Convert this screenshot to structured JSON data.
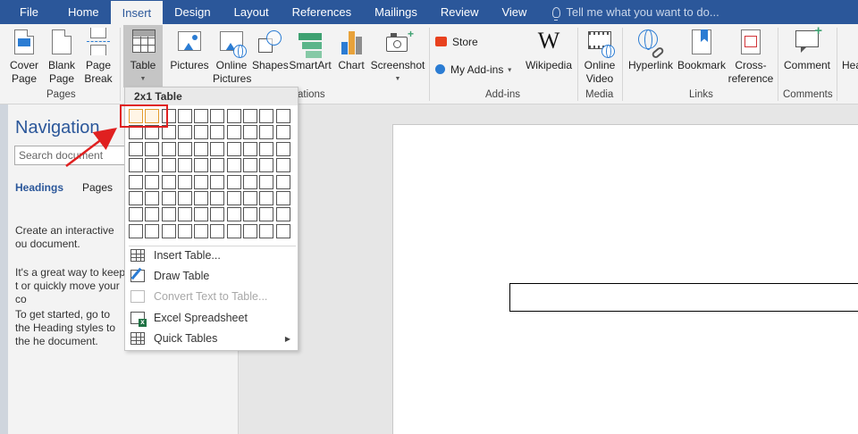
{
  "tabs": [
    "File",
    "Home",
    "Insert",
    "Design",
    "Layout",
    "References",
    "Mailings",
    "Review",
    "View"
  ],
  "active_tab": "Insert",
  "tell_me": "Tell me what you want to do...",
  "ribbon": {
    "cover_page": "Cover\nPage",
    "blank_page": "Blank\nPage",
    "page_break": "Page\nBreak",
    "pages_group": "Pages",
    "table": "Table",
    "pictures": "Pictures",
    "online_pictures": "Online\nPictures",
    "shapes": "Shapes",
    "smartart": "SmartArt",
    "chart": "Chart",
    "screenshot": "Screenshot",
    "illustrations_group_visible": "ations",
    "store": "Store",
    "my_addins": "My Add-ins",
    "wikipedia": "Wikipedia",
    "addins_group": "Add-ins",
    "online_video": "Online\nVideo",
    "media_group": "Media",
    "hyperlink": "Hyperlink",
    "bookmark": "Bookmark",
    "cross_reference": "Cross-\nreference",
    "links_group": "Links",
    "comment": "Comment",
    "comments_group": "Comments",
    "cut_off_button": "Hea"
  },
  "navigation": {
    "title": "Navigation",
    "search_placeholder": "Search document",
    "tab_headings": "Headings",
    "tab_pages": "Pages",
    "para1": "Create an interactive ou document.",
    "para2": "It's a great way to keep t or quickly move your co",
    "para3": "To get started, go to the Heading styles to the he document."
  },
  "table_menu": {
    "header": "2x1 Table",
    "grid_cols": 10,
    "grid_rows": 8,
    "selected_cols": 2,
    "selected_rows": 1,
    "items": [
      {
        "label": "Insert Table...",
        "enabled": true
      },
      {
        "label": "Draw Table",
        "enabled": true
      },
      {
        "label": "Convert Text to Table...",
        "enabled": false
      },
      {
        "label": "Excel Spreadsheet",
        "enabled": true
      },
      {
        "label": "Quick Tables",
        "enabled": true,
        "submenu": true
      }
    ]
  },
  "colors": {
    "word_blue": "#2b579a",
    "annotation_red": "#e02020",
    "grid_selected": "#e39a2b"
  }
}
